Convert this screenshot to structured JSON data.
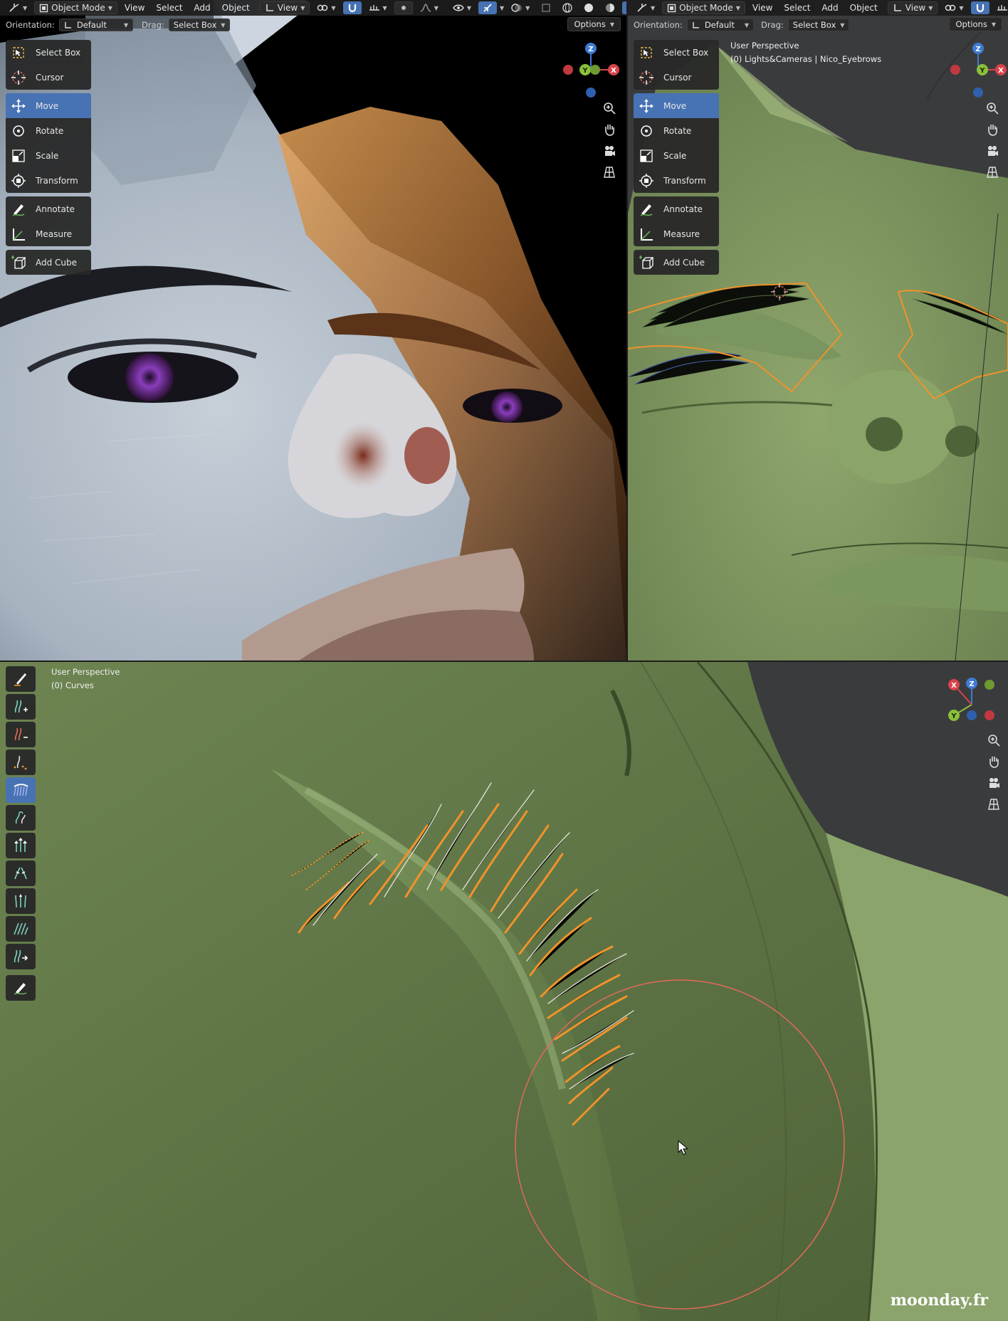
{
  "header": {
    "mode": "Object Mode",
    "menus": [
      "View",
      "Select",
      "Add",
      "Object"
    ],
    "view_label": "View"
  },
  "subheader": {
    "orientation_label": "Orientation:",
    "orientation_value": "Default",
    "drag_label": "Drag:",
    "drag_value": "Select Box",
    "options_label": "Options"
  },
  "toolbar": {
    "select_box": "Select Box",
    "cursor": "Cursor",
    "move": "Move",
    "rotate": "Rotate",
    "scale": "Scale",
    "transform": "Transform",
    "annotate": "Annotate",
    "measure": "Measure",
    "add_cube": "Add Cube"
  },
  "gizmo": {
    "x": "X",
    "y": "Y",
    "z": "Z"
  },
  "viewport_right": {
    "perspective": "User Perspective",
    "object": "(0) Lights&Cameras | Nico_Eyebrows"
  },
  "viewport_bottom": {
    "perspective": "User Perspective",
    "object": "(0) Curves"
  },
  "watermark": "moonday.fr",
  "colors": {
    "accent": "#4772b3",
    "axis_x": "#d9434b",
    "axis_y": "#8bc03c",
    "axis_z": "#3f7ad4",
    "selection": "#f0932a",
    "brush_circle": "#e06a5a"
  }
}
